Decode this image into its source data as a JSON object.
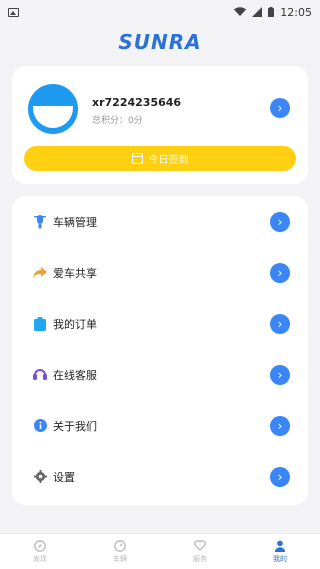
{
  "status_bar": {
    "time": "12:05",
    "wifi_icon": "wifi-icon",
    "signal_icon": "signal-icon",
    "battery_icon": "battery-icon"
  },
  "brand": {
    "logo_text": "SUNRA",
    "color": "#2b72d6"
  },
  "profile": {
    "username": "xr7224235646",
    "points_text": "总积分：0分",
    "checkin_label": "今日签到"
  },
  "menu": {
    "items": [
      {
        "label": "车辆管理",
        "icon": "scooter-icon"
      },
      {
        "label": "爱车共享",
        "icon": "share-arrow-icon"
      },
      {
        "label": "我的订单",
        "icon": "clipboard-icon"
      },
      {
        "label": "在线客服",
        "icon": "headset-icon"
      },
      {
        "label": "关于我们",
        "icon": "info-icon"
      },
      {
        "label": "设置",
        "icon": "gear-icon"
      }
    ]
  },
  "tabbar": {
    "tabs": [
      {
        "label": "发现",
        "icon": "compass-icon"
      },
      {
        "label": "车辆",
        "icon": "gauge-icon"
      },
      {
        "label": "服务",
        "icon": "heart-icon"
      },
      {
        "label": "我的",
        "icon": "person-icon",
        "active": true
      }
    ]
  },
  "colors": {
    "accent": "#3a86f5",
    "checkin": "#ffcf12"
  }
}
